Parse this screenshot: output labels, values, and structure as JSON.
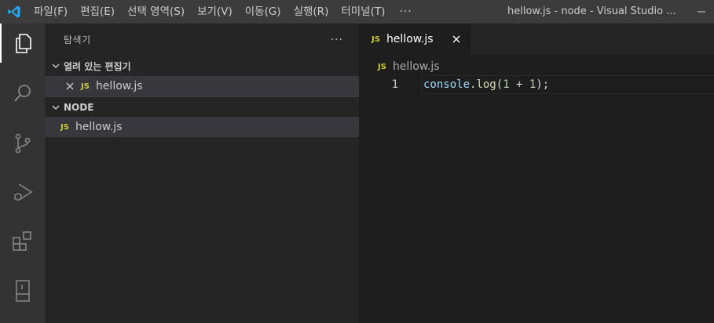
{
  "titlebar": {
    "menus": [
      "파일(F)",
      "편집(E)",
      "선택 영역(S)",
      "보기(V)",
      "이동(G)",
      "실행(R)",
      "터미널(T)"
    ],
    "more": "···",
    "window_title": "hellow.js - node - Visual Studio ..."
  },
  "activity_bar": {
    "items": [
      "explorer-icon",
      "search-icon",
      "source-control-icon",
      "run-debug-icon",
      "extensions-icon",
      "remote-explorer-icon"
    ],
    "active": "explorer-icon"
  },
  "sidebar": {
    "title": "탐색기",
    "more": "···",
    "open_editors": {
      "label": "열려 있는 편집기",
      "files": [
        {
          "badge": "JS",
          "name": "hellow.js"
        }
      ]
    },
    "folder": {
      "label": "NODE",
      "files": [
        {
          "badge": "JS",
          "name": "hellow.js"
        }
      ]
    }
  },
  "editor": {
    "tab": {
      "badge": "JS",
      "label": "hellow.js"
    },
    "breadcrumb": "hellow.js",
    "lines": [
      {
        "number": "1",
        "tokens": [
          {
            "text": "console",
            "kind": "var"
          },
          {
            "text": ".",
            "kind": "punc"
          },
          {
            "text": "log",
            "kind": "fn"
          },
          {
            "text": "(",
            "kind": "punc"
          },
          {
            "text": "1",
            "kind": "num"
          },
          {
            "text": " + ",
            "kind": "punc"
          },
          {
            "text": "1",
            "kind": "num"
          },
          {
            "text": ");",
            "kind": "punc"
          }
        ]
      }
    ]
  },
  "colors": {
    "titlebar_bg": "#3c3c3c",
    "activity_bg": "#333333",
    "sidebar_bg": "#252526",
    "editor_bg": "#1e1e1e",
    "js_badge": "#cbcb41",
    "vscode_blue": "#23a9f2"
  }
}
